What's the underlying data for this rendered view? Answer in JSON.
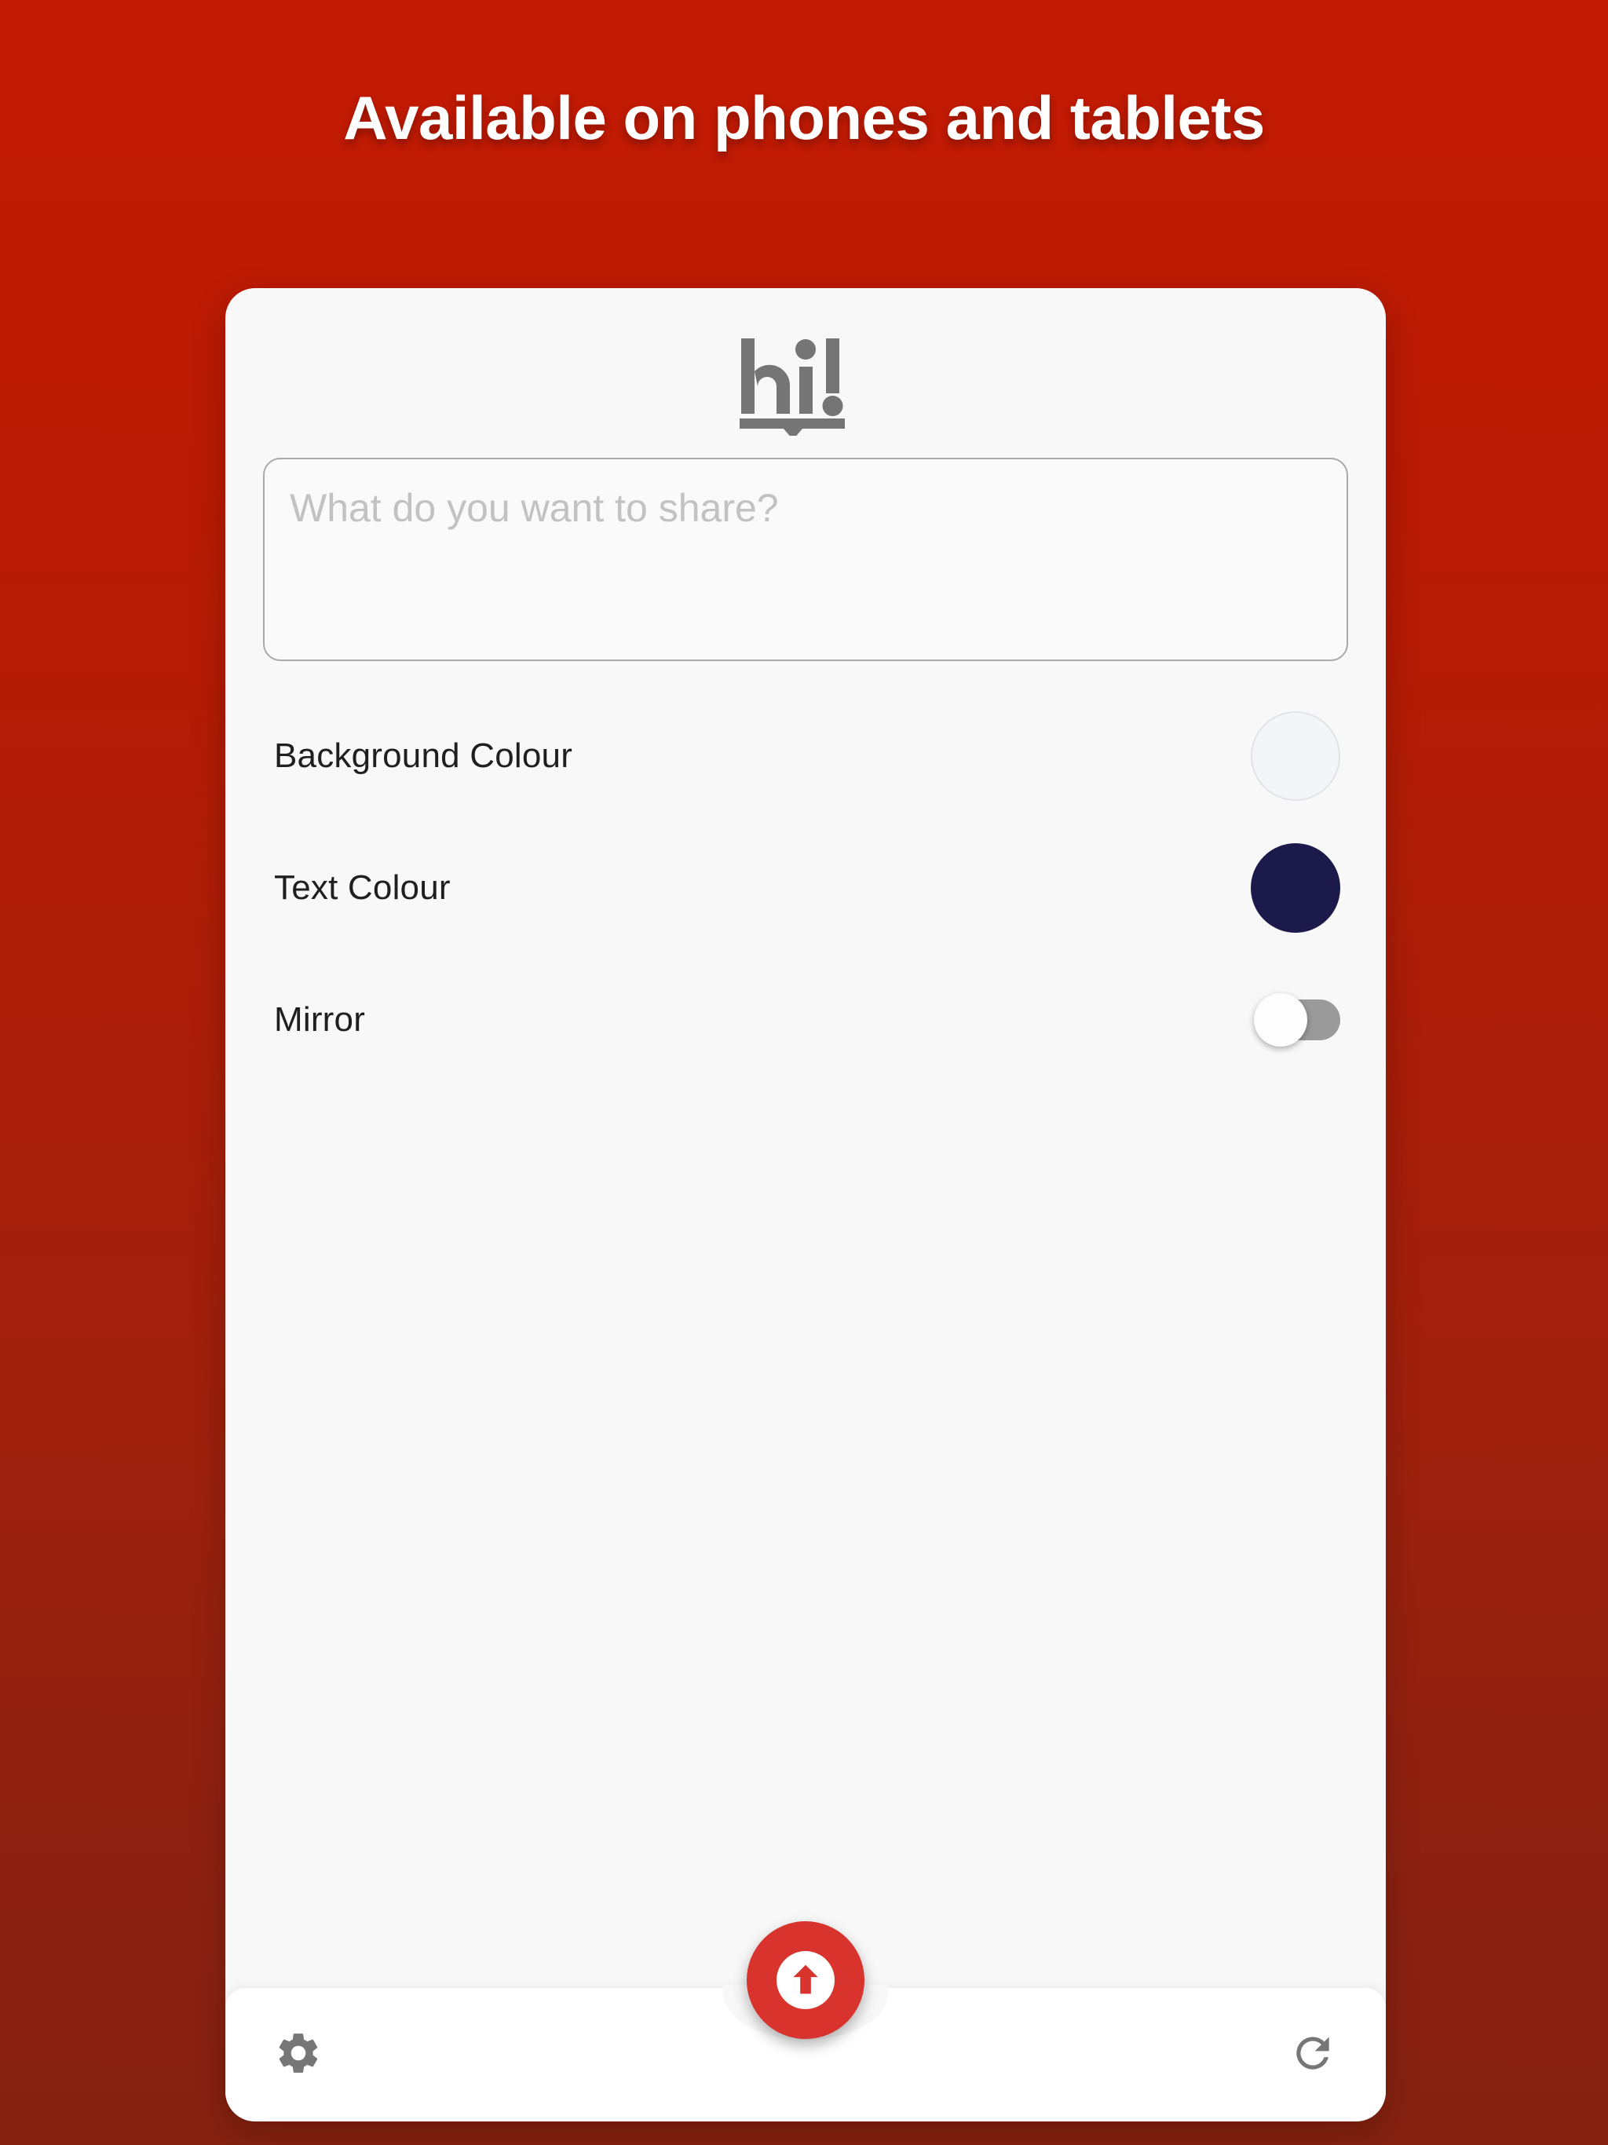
{
  "headline": "Available on phones and tablets",
  "app": {
    "logo_text": "hi!",
    "logo_icon_name": "hi-speech-logo"
  },
  "compose": {
    "placeholder": "What do you want to share?",
    "value": ""
  },
  "settings": [
    {
      "label": "Background Colour",
      "control": "color-swatch",
      "value": "#f4f5f9",
      "icon_name": "background-colour-swatch"
    },
    {
      "label": "Text Colour",
      "control": "color-swatch",
      "value": "#1b1a4b",
      "icon_name": "text-colour-swatch"
    },
    {
      "label": "Mirror",
      "control": "toggle",
      "value": "off",
      "icon_name": "mirror-toggle"
    }
  ],
  "bottom_bar": {
    "left_icon": "gear-icon",
    "right_icon": "refresh-icon",
    "fab_icon": "arrow-up-icon"
  },
  "colors": {
    "background_top": "#c21a03",
    "background_bottom": "#852110",
    "card": "#f8f8f8",
    "accent": "#d8332d",
    "icon_gray": "#767676",
    "logo_gray": "#757575",
    "toggle_track": "#9a9a9a"
  }
}
